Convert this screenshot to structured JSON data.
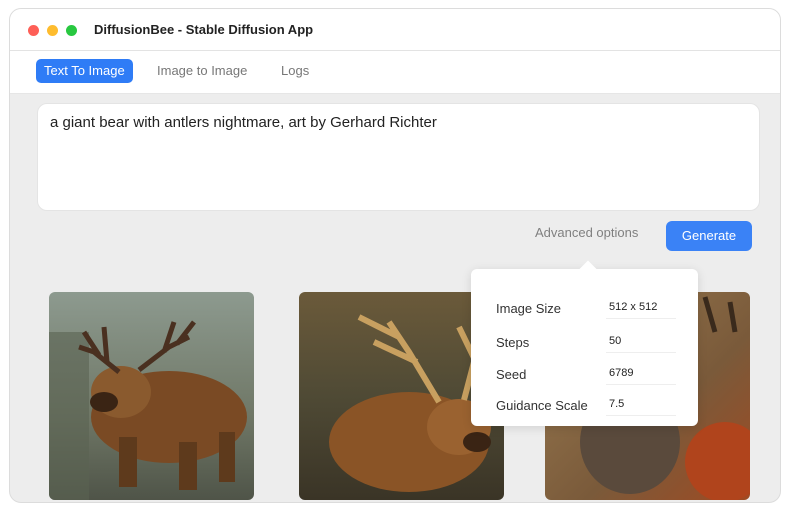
{
  "window": {
    "title": "DiffusionBee - Stable Diffusion App"
  },
  "tabs": [
    {
      "label": "Text To Image",
      "active": true
    },
    {
      "label": "Image to Image",
      "active": false
    },
    {
      "label": "Logs",
      "active": false
    }
  ],
  "prompt": {
    "value": "a giant bear with antlers nightmare, art by Gerhard Richter"
  },
  "actions": {
    "advanced_label": "Advanced options",
    "generate_label": "Generate"
  },
  "advanced_options": [
    {
      "label": "Image Size",
      "value": "512 x 512"
    },
    {
      "label": "Steps",
      "value": "50"
    },
    {
      "label": "Seed",
      "value": "6789"
    },
    {
      "label": "Guidance Scale",
      "value": "7.5"
    }
  ],
  "colors": {
    "accent": "#2f7cf6",
    "window_bg": "#ededed"
  }
}
